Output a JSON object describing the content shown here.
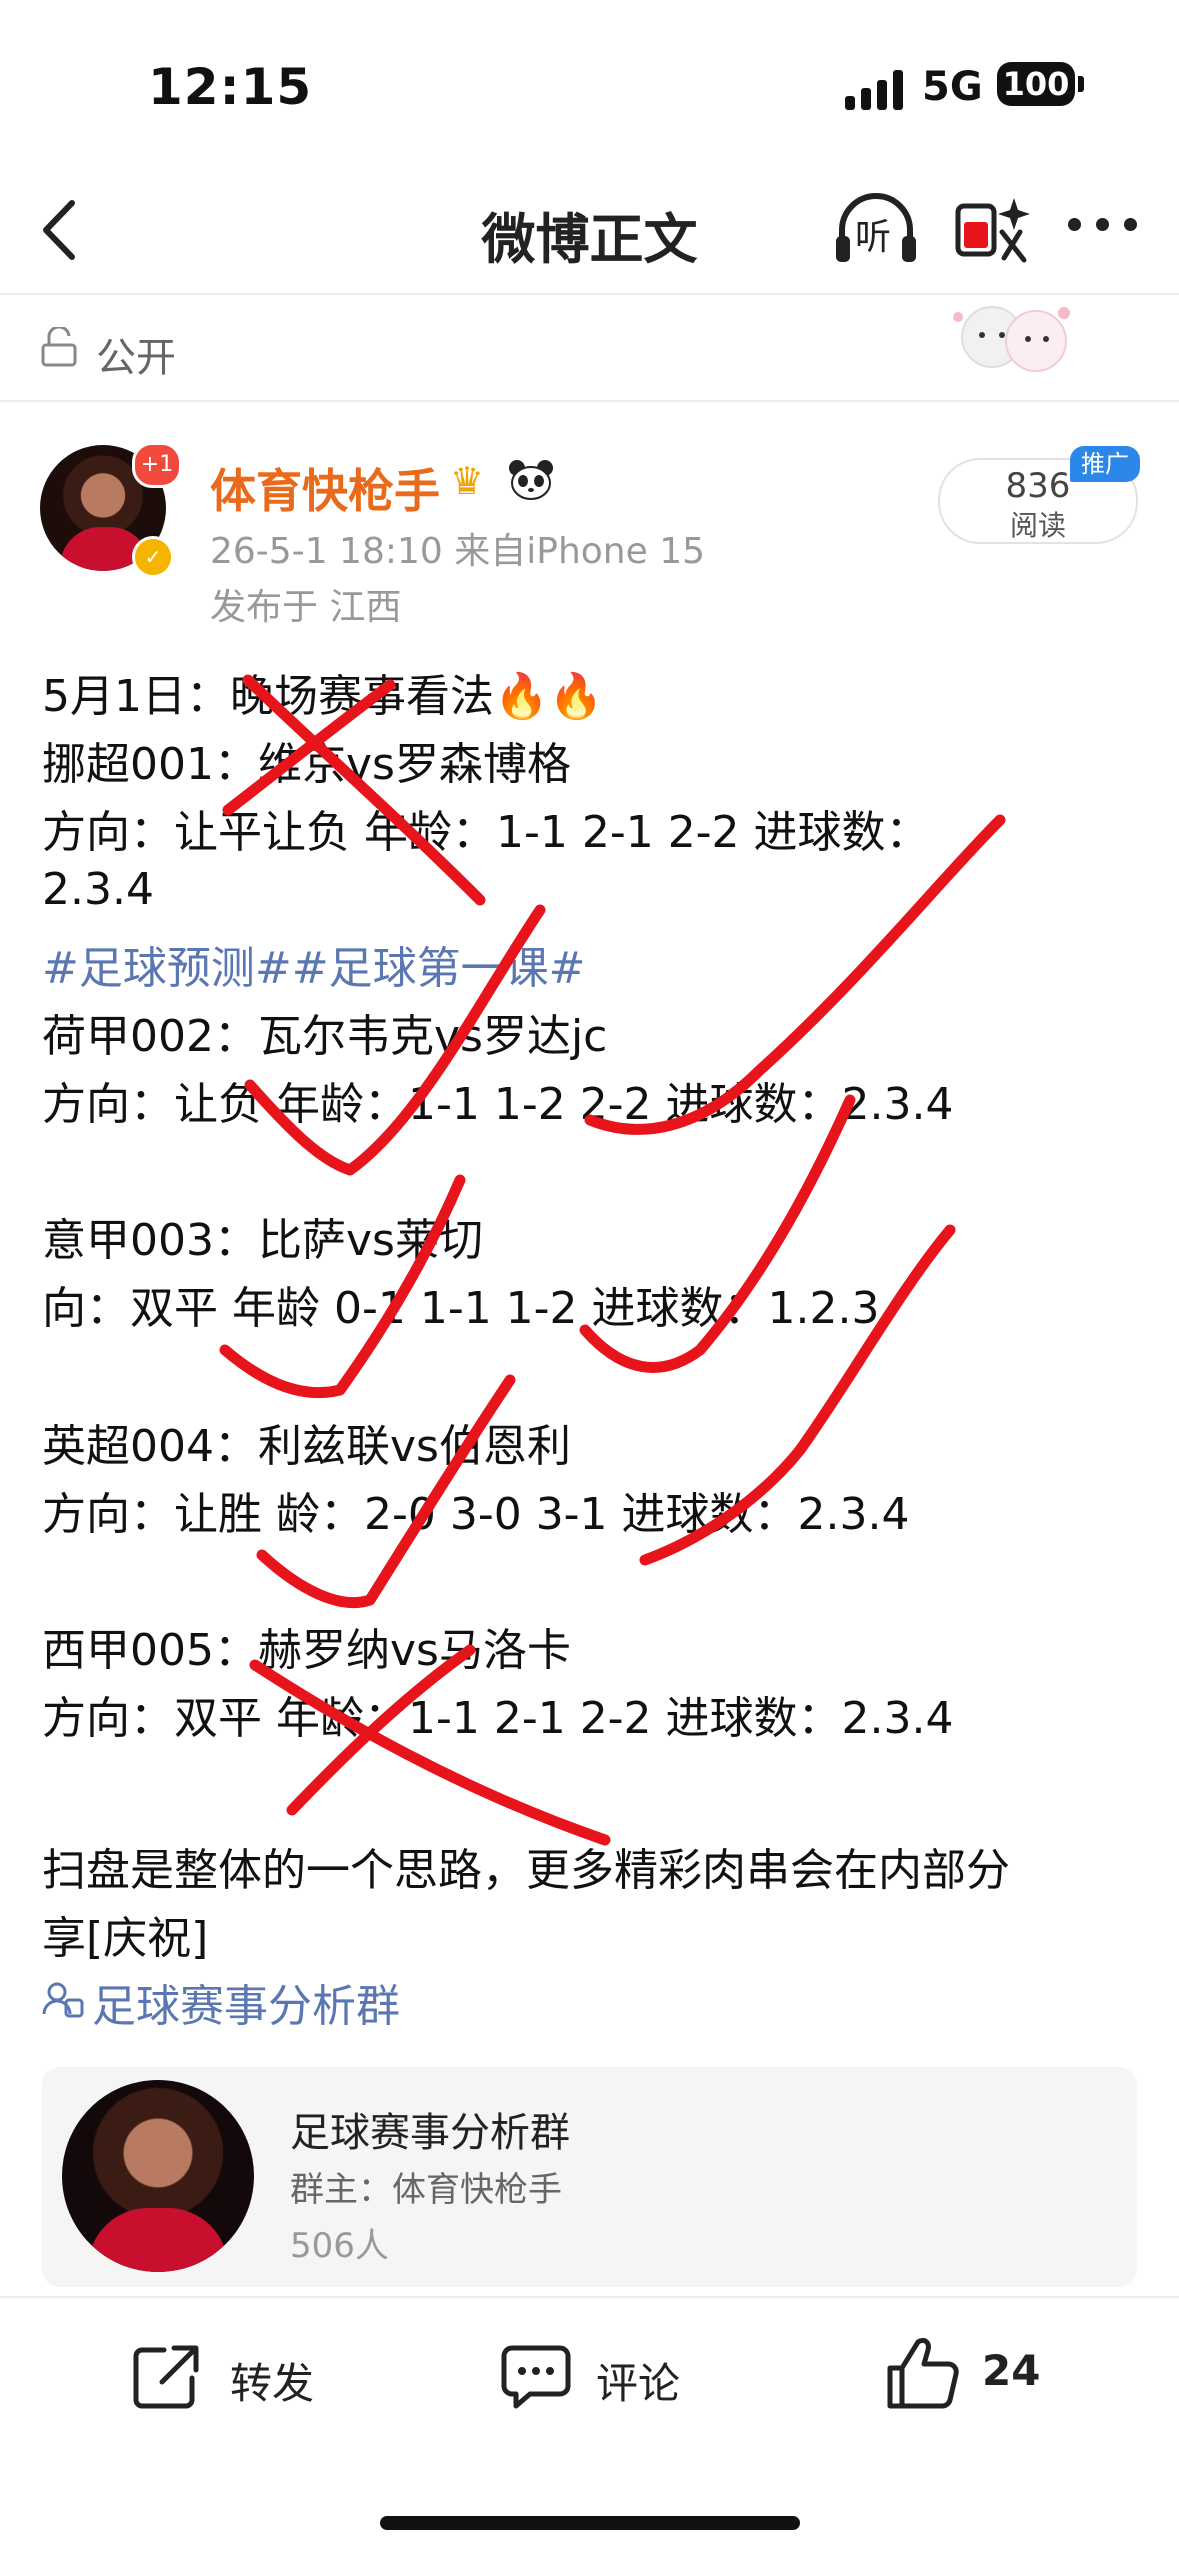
{
  "status_bar": {
    "time": "12:15",
    "network": "5G",
    "battery": "100"
  },
  "nav": {
    "title": "微博正文",
    "listen_label": "听"
  },
  "visibility": {
    "label": "公开"
  },
  "author": {
    "name": "体育快枪手",
    "badge_count": "+1",
    "meta": "26-5-1 18:10  来自iPhone 15",
    "location": "发布于 江西"
  },
  "reads": {
    "count": "836",
    "label": "阅读",
    "promo": "推广"
  },
  "post": {
    "lines": [
      "5月1日：晚场赛事看法🔥🔥",
      "挪超001：维京vs罗森博格",
      "方向：让平让负 年龄：1-1 2-1 2-2  进球数：",
      "2.3.4",
      "#足球预测##足球第一课#",
      "荷甲002：瓦尔韦克vs罗达jc",
      "方向：让负  年龄：1-1 1-2 2-2  进球数：2.3.4",
      "意甲003：比萨vs莱切",
      "向：双平   年龄    0-1  1-1  1-2    进球数：1.2.3",
      "英超004：利兹联vs伯恩利",
      "方向：让胜  龄：2-0  3-0  3-1  进球数：2.3.4",
      "西甲005：赫罗纳vs马洛卡",
      "方向：双平   年龄：1-1  2-1  2-2    进球数：2.3.4",
      "扫盘是整体的一个思路，更多精彩肉串会在内部分",
      "享[庆祝]"
    ],
    "group_link": "足球赛事分析群"
  },
  "group_card": {
    "title": "足球赛事分析群",
    "owner": "群主：体育快枪手",
    "count": "506人"
  },
  "actions": {
    "repost": "转发",
    "comment": "评论",
    "like_count": "24"
  },
  "colors": {
    "author_name": "#ea6a1c",
    "topic_link": "#5a77b2",
    "ink": "#e8141b"
  }
}
